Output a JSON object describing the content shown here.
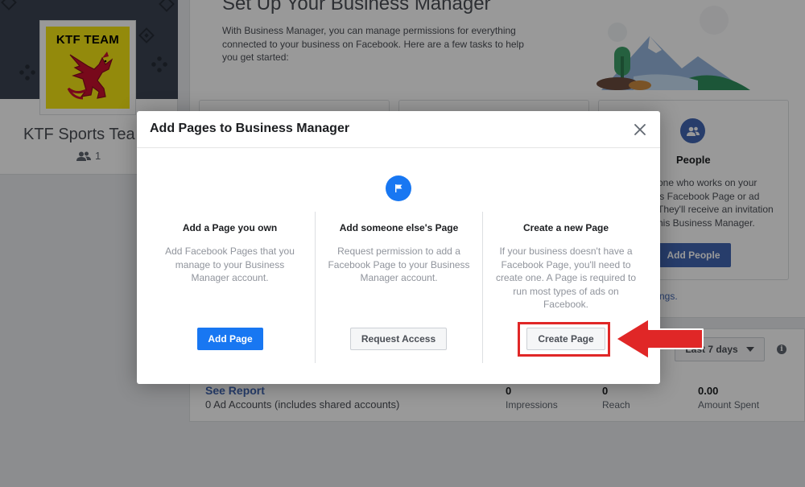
{
  "team": {
    "logo_text": "KTF TEAM",
    "name": "KTF Sports Tea",
    "member_count": "1"
  },
  "setup": {
    "title": "Set Up Your Business Manager",
    "description": "With Business Manager, you can manage permissions for everything connected to your business on Facebook. Here are a few tasks to help you get started:"
  },
  "people_task": {
    "title": "People",
    "description": "one who works on your\n's Facebook Page or ad\nThey'll receive an invitation\nhis Business Manager.",
    "button_label": "Add People",
    "link_fragment": "ngs."
  },
  "report": {
    "range_label": "Last 7 days",
    "see_report": "See Report",
    "ad_accounts": "0 Ad Accounts (includes shared accounts)",
    "stats": [
      {
        "value": "0",
        "label": "Impressions"
      },
      {
        "value": "0",
        "label": "Reach"
      },
      {
        "value": "0.00",
        "label": "Amount Spent"
      }
    ]
  },
  "modal": {
    "title": "Add Pages to Business Manager",
    "columns": [
      {
        "title": "Add a Page you own",
        "description": "Add Facebook Pages that you\nmanage to your Business\nManager account.",
        "button_label": "Add Page"
      },
      {
        "title": "Add someone else's Page",
        "description": "Request permission to add a\nFacebook Page to your Business\nManager account.",
        "button_label": "Request Access"
      },
      {
        "title": "Create a new Page",
        "description": "If your business doesn't have a\nFacebook Page, you'll need to\ncreate one. A Page is required to\nrun most types of ads on\nFacebook.",
        "button_label": "Create Page"
      }
    ]
  },
  "colors": {
    "facebook_blue": "#1877f2",
    "business_blue": "#4267b2",
    "annotation_red": "#e02727"
  },
  "icons": [
    "people-icon",
    "flag-icon",
    "close-icon",
    "chevron-down-icon",
    "info-icon",
    "red-arrow-annotation"
  ]
}
